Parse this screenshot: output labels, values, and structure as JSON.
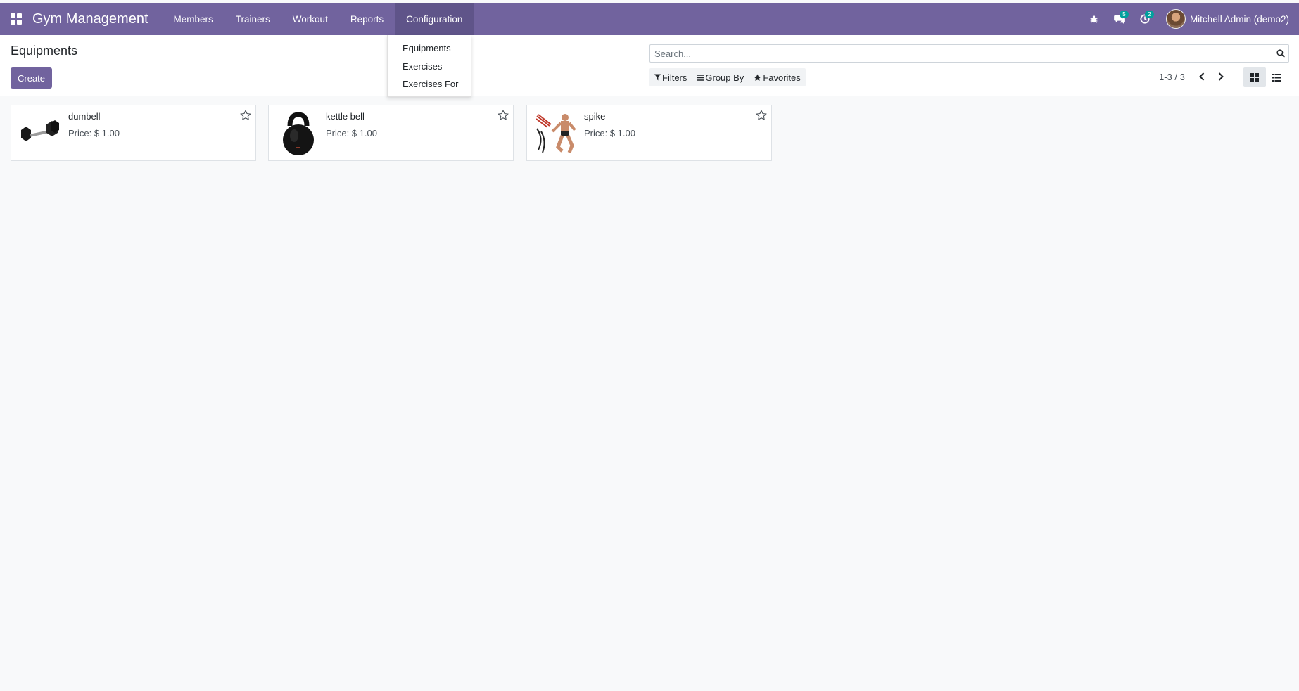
{
  "app": {
    "brand": "Gym Management",
    "menu": [
      "Members",
      "Trainers",
      "Workout",
      "Reports",
      "Configuration"
    ],
    "messages_count": "5",
    "activities_count": "2",
    "user": "Mitchell Admin (demo2)",
    "accent_color": "#71639e"
  },
  "dropdown": {
    "items": [
      "Equipments",
      "Exercises",
      "Exercises For"
    ]
  },
  "control": {
    "title": "Equipments",
    "create_label": "Create",
    "search_placeholder": "Search...",
    "filters_label": "Filters",
    "groupby_label": "Group By",
    "favorites_label": "Favorites",
    "pager": "1-3 / 3"
  },
  "cards": [
    {
      "name": "dumbell",
      "price": "Price: $ 1.00",
      "image": "dumbbell-image"
    },
    {
      "name": "kettle bell",
      "price": "Price: $ 1.00",
      "image": "kettlebell-image"
    },
    {
      "name": "spike",
      "price": "Price: $ 1.00",
      "image": "resistance-bands-image"
    }
  ]
}
